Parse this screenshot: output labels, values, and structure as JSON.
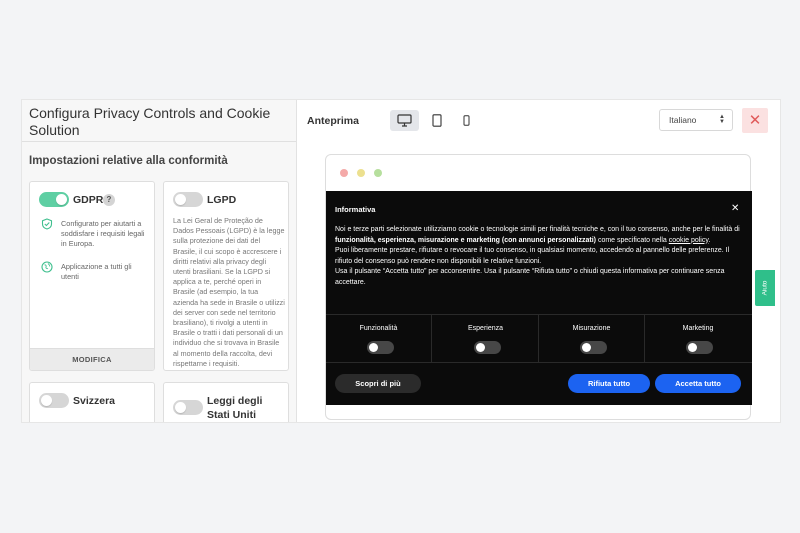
{
  "panel": {
    "title": "Configura Privacy Controls and Cookie Solution",
    "section_title": "Impostazioni relative alla conformità"
  },
  "cards": {
    "gdpr": {
      "name": "GDPR",
      "enabled": true,
      "help": "?",
      "features": [
        {
          "icon": "shield-check-icon",
          "text": "Configurato per aiutarti a soddisfare i requisiti legali in Europa."
        },
        {
          "icon": "globe-icon",
          "text": "Applicazione a tutti gli utenti"
        }
      ],
      "action": "MODIFICA"
    },
    "lgpd": {
      "name": "LGPD",
      "enabled": false,
      "description": "La Lei Geral de Proteção de Dados Pessoais (LGPD) è la legge sulla protezione dei dati del Brasile, il cui scopo è accrescere i diritti relativi alla privacy degli utenti brasiliani. Se la LGPD si applica a te, perché operi in Brasile (ad esempio, la tua azienda ha sede in Brasile o utilizzi dei server con sede nel territorio brasiliano), ti rivolgi a utenti in Brasile o tratti i dati personali di un individuo che si trovava in Brasile al momento della raccolta, devi rispettarne i requisiti."
    },
    "svizzera": {
      "name": "Svizzera",
      "enabled": false
    },
    "usa": {
      "name": "Leggi degli Stati Uniti",
      "enabled": false
    }
  },
  "preview": {
    "label": "Anteprima",
    "devices": [
      {
        "name": "desktop-icon",
        "active": true
      },
      {
        "name": "tablet-icon",
        "active": false
      },
      {
        "name": "mobile-icon",
        "active": false
      }
    ],
    "language": "Italiano",
    "close": "✕"
  },
  "browser_dots": {
    "colors": [
      "#f4a9a8",
      "#ece08f",
      "#b6df9d"
    ]
  },
  "banner": {
    "title": "Informativa",
    "close": "✕",
    "text": {
      "p1_a": "Noi e terze parti selezionate utilizziamo cookie o tecnologie simili per finalità tecniche e, con il tuo consenso, anche per le finalità di ",
      "p1_b": "funzionalità, esperienza, misurazione e marketing (con annunci personalizzati)",
      "p1_c": " come specificato nella ",
      "p1_link": "cookie policy",
      "p1_d": ".",
      "p2": "Puoi liberamente prestare, rifiutare o revocare il tuo consenso, in qualsiasi momento, accedendo al pannello delle preferenze. Il rifiuto del consenso può rendere non disponibili le relative funzioni.",
      "p3": "Usa il pulsante “Accetta tutto” per acconsentire. Usa il pulsante “Rifiuta tutto” o chiudi questa informativa per continuare senza accettare."
    },
    "categories": [
      {
        "label": "Funzionalità",
        "enabled": false
      },
      {
        "label": "Esperienza",
        "enabled": false
      },
      {
        "label": "Misurazione",
        "enabled": false
      },
      {
        "label": "Marketing",
        "enabled": false
      }
    ],
    "buttons": {
      "learn_more": "Scopri di più",
      "reject_all": "Rifiuta tutto",
      "accept_all": "Accetta tutto"
    }
  },
  "help_tab": "Aiuto",
  "colors": {
    "accent_green": "#5ecfa3",
    "button_blue": "#1c63f1",
    "close_red": "#e05a5a"
  }
}
